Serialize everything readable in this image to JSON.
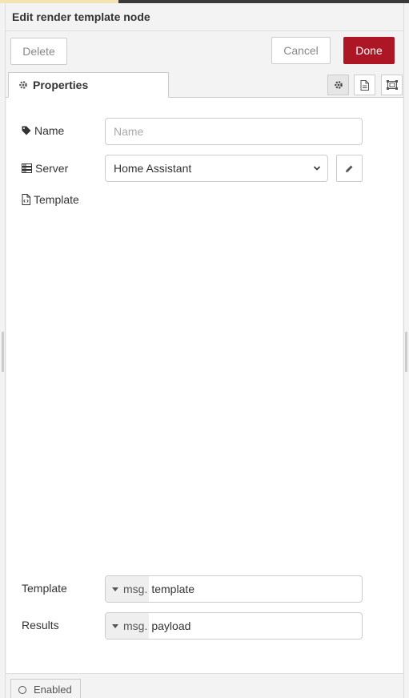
{
  "header": {
    "title": "Edit render template node"
  },
  "toolbar": {
    "delete_label": "Delete",
    "cancel_label": "Cancel",
    "done_label": "Done"
  },
  "tabs": {
    "properties_label": "Properties"
  },
  "form": {
    "name_label": "Name",
    "name_placeholder": "Name",
    "name_value": "",
    "server_label": "Server",
    "server_value": "Home Assistant",
    "template_editor_label": "Template",
    "template_label": "Template",
    "template_type": "msg.",
    "template_value": "template",
    "results_label": "Results",
    "results_type": "msg.",
    "results_value": "payload"
  },
  "footer": {
    "enabled_label": "Enabled"
  },
  "colors": {
    "done_button": "#ad1625",
    "tray_bg": "#f3f3f3",
    "panel_bg": "#ffffff"
  }
}
